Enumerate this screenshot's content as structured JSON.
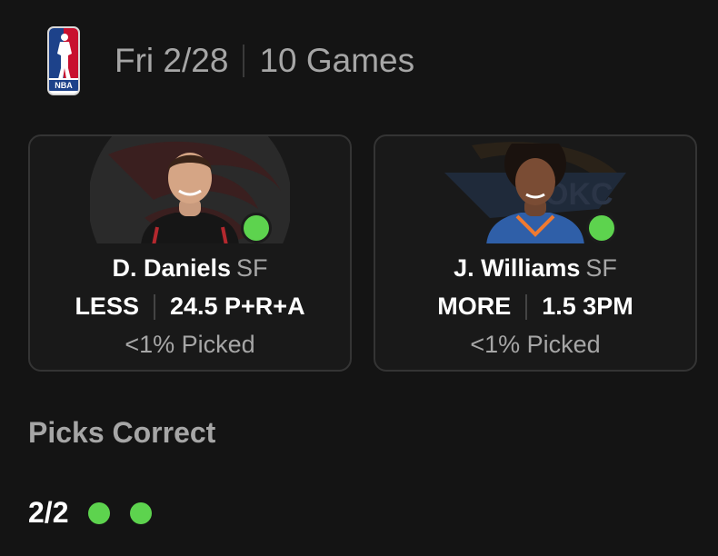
{
  "header": {
    "logo_text": "NBA",
    "date": "Fri 2/28",
    "games": "10 Games"
  },
  "picks": [
    {
      "name": "D. Daniels",
      "position": "SF",
      "direction": "LESS",
      "line": "24.5 P+R+A",
      "picked": "<1% Picked",
      "team_icon": "hawks-logo",
      "status": "correct",
      "status_color": "#5dd34e"
    },
    {
      "name": "J. Williams",
      "position": "SF",
      "direction": "MORE",
      "line": "1.5 3PM",
      "picked": "<1% Picked",
      "team_icon": "thunder-logo",
      "status": "correct",
      "status_color": "#5dd34e"
    }
  ],
  "results": {
    "title": "Picks Correct",
    "score": "2/2",
    "correct_count": 2,
    "total": 2
  },
  "colors": {
    "background": "#141414",
    "card_background": "#191919",
    "card_border": "#343434",
    "success": "#5dd34e",
    "muted_text": "#a6a6a6"
  }
}
